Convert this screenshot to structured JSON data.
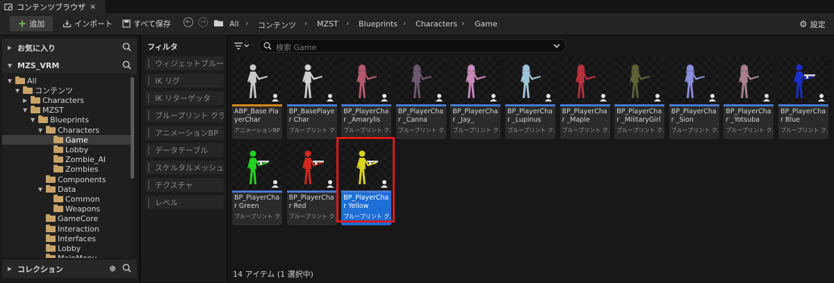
{
  "tab": {
    "title": "コンテンツブラウザ",
    "close": "×"
  },
  "toolbar": {
    "add_label": "追加",
    "import_label": "インポート",
    "save_all_label": "すべて保存",
    "settings_label": "設定"
  },
  "breadcrumb": [
    "All",
    "コンテンツ",
    "MZST",
    "Blueprints",
    "Characters",
    "Game"
  ],
  "left": {
    "favorites": "お気に入り",
    "project": "MZS_VRM",
    "collections": "コレクション",
    "tree": [
      {
        "label": "All",
        "depth": 0,
        "open": true
      },
      {
        "label": "コンテンツ",
        "depth": 1,
        "open": true
      },
      {
        "label": "Characters",
        "depth": 2,
        "open": false
      },
      {
        "label": "MZST",
        "depth": 2,
        "open": true
      },
      {
        "label": "Blueprints",
        "depth": 3,
        "open": true
      },
      {
        "label": "Characters",
        "depth": 4,
        "open": true
      },
      {
        "label": "Game",
        "depth": 5,
        "selected": true
      },
      {
        "label": "Lobby",
        "depth": 5
      },
      {
        "label": "Zombie_AI",
        "depth": 5
      },
      {
        "label": "Zombies",
        "depth": 5
      },
      {
        "label": "Components",
        "depth": 4
      },
      {
        "label": "Data",
        "depth": 4,
        "open": true
      },
      {
        "label": "Common",
        "depth": 5
      },
      {
        "label": "Weapons",
        "depth": 5
      },
      {
        "label": "GameCore",
        "depth": 4
      },
      {
        "label": "Interaction",
        "depth": 4
      },
      {
        "label": "Interfaces",
        "depth": 4
      },
      {
        "label": "Lobby",
        "depth": 4
      },
      {
        "label": "MainMenu",
        "depth": 4
      }
    ]
  },
  "filter": {
    "title": "フィルタ",
    "items": [
      "ウィジェットブループ",
      "IK リグ",
      "IK リターゲッタ",
      "ブループリント クラ",
      "アニメーションBP",
      "データテーブル",
      "スケルタルメッシュ",
      "テクスチャ",
      "レベル"
    ]
  },
  "search": {
    "placeholder": "検索 Game"
  },
  "assets": [
    {
      "name": "ABP_Base PlayerChar",
      "type": "アニメーションBP",
      "bar": "orange",
      "fig": "#c9c9c9",
      "kind": "gray"
    },
    {
      "name": "BP_BasePlayer Char",
      "type": "ブループリント ク...",
      "fig": "#cfcfcf",
      "kind": "gray"
    },
    {
      "name": "BP_PlayerChar _Amarylis",
      "type": "ブループリント ク...",
      "fig": "#b45a6e",
      "kind": "anime"
    },
    {
      "name": "BP_PlayerChar _Canna",
      "type": "ブループリント ク...",
      "fig": "#6e5870",
      "kind": "anime"
    },
    {
      "name": "BP_PlayerChar _Jay_",
      "type": "ブループリント ク...",
      "fig": "#c58ab8",
      "kind": "anime"
    },
    {
      "name": "BP_PlayerChar _Lupinus",
      "type": "ブループリント ク...",
      "fig": "#9fc4d8",
      "kind": "anime"
    },
    {
      "name": "BP_PlayerChar _Maple",
      "type": "ブループリント ク...",
      "fig": "#b8303c",
      "kind": "anime"
    },
    {
      "name": "BP_PlayerChar _MilitaryGirl",
      "type": "ブループリント ク...",
      "fig": "#5e6236",
      "kind": "anime"
    },
    {
      "name": "BP_PlayerChar _Sion",
      "type": "ブループリント ク...",
      "fig": "#8a8ed8",
      "kind": "anime"
    },
    {
      "name": "BP_PlayerChar _Yotsuba",
      "type": "ブループリント ク...",
      "fig": "#a88090",
      "kind": "anime"
    },
    {
      "name": "BP_PlayerChar Blue",
      "type": "ブループリント ク...",
      "fig": "#1c2fc8",
      "kind": "color"
    },
    {
      "name": "BP_PlayerChar Green",
      "type": "ブループリント ク...",
      "fig": "#22d422",
      "kind": "color"
    },
    {
      "name": "BP_PlayerChar Red",
      "type": "ブループリント ク...",
      "fig": "#d42a1e",
      "kind": "color"
    },
    {
      "name": "BP_PlayerChar Yellow",
      "type": "ブループリント ク...",
      "fig": "#d8d21e",
      "kind": "color",
      "selected": true
    }
  ],
  "status": "14 アイテム (1 選択中)",
  "colors": {
    "accent": "#1e6fd6",
    "asset_bar": "#4a7bd6",
    "anim_bar": "#d98a1e",
    "highlight": "#e01818",
    "folder": "#c8a266",
    "add_plus": "#6fc24a"
  }
}
